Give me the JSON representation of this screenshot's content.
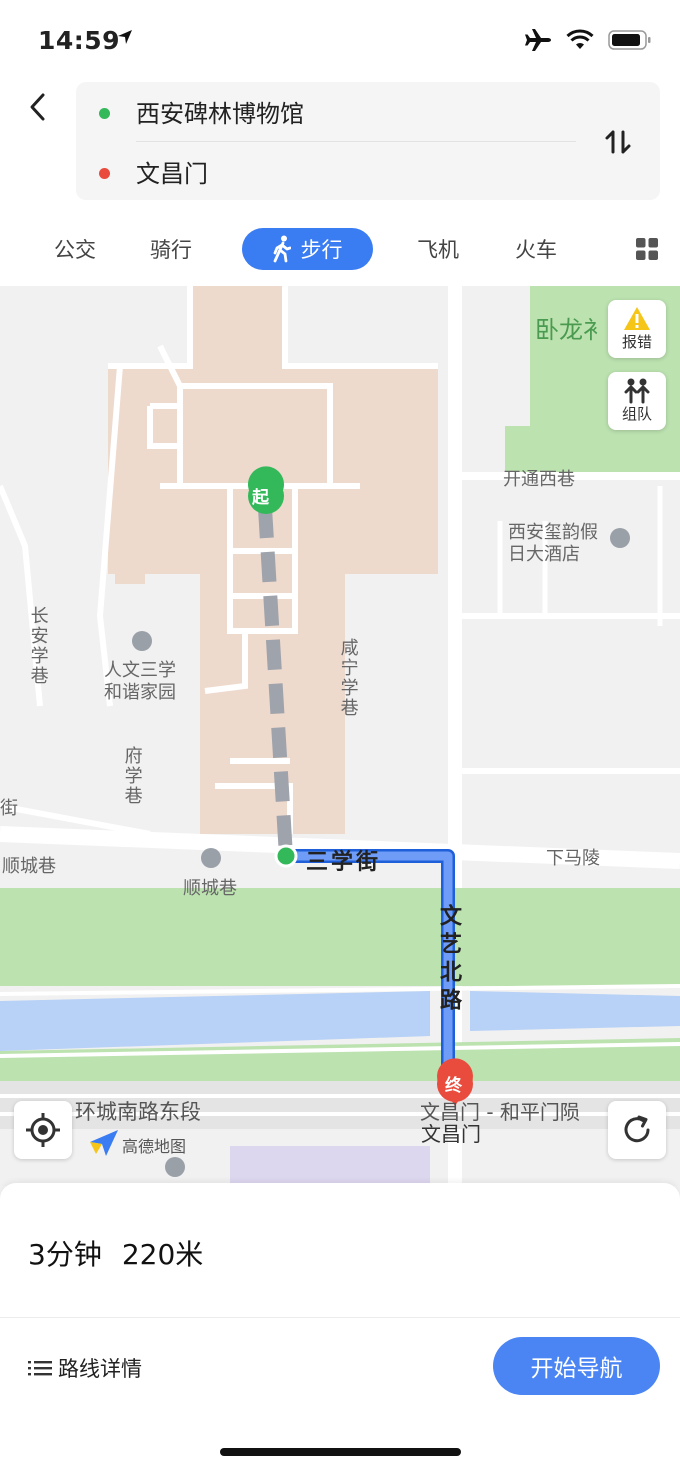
{
  "status": {
    "time": "14:59"
  },
  "route": {
    "from": "西安碑林博物馆",
    "to": "文昌门"
  },
  "modes": [
    {
      "label": "公交"
    },
    {
      "label": "骑行"
    },
    {
      "label": "步行",
      "active": true
    },
    {
      "label": "飞机"
    },
    {
      "label": "火车"
    }
  ],
  "map": {
    "labels": {
      "wolong": "卧龙衤",
      "kaitong": "开通西巷",
      "hotel": "西安玺韵假日大酒店",
      "changan": "长安学巷",
      "renwen": "人文三学和谐家园",
      "xianning": "咸宁学巷",
      "fuxue": "府学巷",
      "jie": "街",
      "shuncheng": "顺城巷",
      "shuncheng_poi": "顺城巷",
      "xiamaling": "下马陵",
      "sanxue": "三学街",
      "wenyi": "文艺北路",
      "huancheng": "环城南路东段",
      "wenchangmen_gate": "文昌门 - 和平门陨",
      "wenchangmen": "文昌门",
      "logo": "高德地图"
    },
    "markers": {
      "start": "起",
      "end": "终"
    },
    "buttons": {
      "report": "报错",
      "team": "组队"
    }
  },
  "summary": {
    "duration": "3分钟",
    "distance": "220米"
  },
  "actions": {
    "details": "路线详情",
    "start_nav": "开始导航"
  },
  "colors": {
    "accent": "#3a7cf2",
    "start": "#33b85a",
    "end": "#e94b3c",
    "walk_route": "#9fa3ab"
  }
}
